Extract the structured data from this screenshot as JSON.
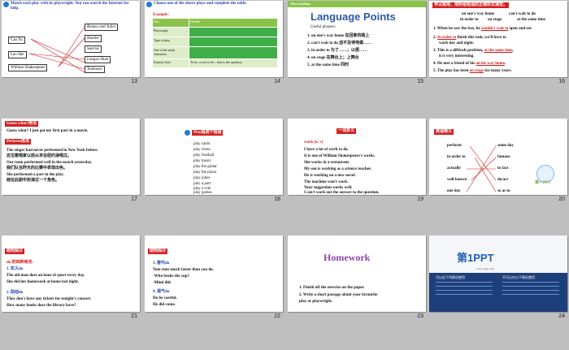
{
  "slides": {
    "s13": {
      "number": "13",
      "instruction": "Match each play with its playwright. You can search the Internet for help.",
      "playwrights": [
        "Cao Yu",
        "Lao She",
        "William Shakespeare"
      ],
      "plays": [
        "Romeo and Juliet",
        "Hamlet",
        "Sunrise",
        "Longxu Slum",
        "Teahouse",
        "Thunderstorm",
        "Camel Xiangzi"
      ]
    },
    "s14": {
      "number": "14",
      "instruction": "Choose one of the above plays and complete the table.",
      "example_label": "Example:",
      "rows": [
        {
          "label": "Play",
          "value": "Hamlet"
        },
        {
          "label": "Playwright",
          "value": ""
        },
        {
          "label": "Type of play",
          "value": ""
        },
        {
          "label": "One of the main characters",
          "value": ""
        },
        {
          "label": "Famous Line",
          "value": "To be, or not to be – that is the question."
        }
      ]
    },
    "s15": {
      "number": "15",
      "tag": "Post-reading",
      "title": "Language Points",
      "subtitle": "Useful phrases:",
      "items": [
        "1.  on one's way home  在回家的路上",
        "2.  can't wait to do  迫不及待地做……",
        "3.  in order to  为了……；以便……",
        "4.  on stage  在舞台上；上舞台",
        "5.  at the same time  同时"
      ]
    },
    "s16": {
      "number": "16",
      "tag": "学以致用，用所给短语的正确形式填空。",
      "phrase_row1": [
        "on one's way home",
        "can't wait to do"
      ],
      "phrase_row2": [
        "in order to",
        "on stage",
        "at the same time"
      ],
      "sentences": [
        {
          "pre": "1. When he saw the box, he ",
          "ans": "couldn't wait to",
          "post": " open and see"
        },
        {
          "pre": "2. ",
          "ans": "In order to",
          "post": " finish this task, we'll have to"
        },
        {
          "pre": "work day and night.",
          "ans": "",
          "post": ""
        },
        {
          "pre": "3. This is a difficult problem, ",
          "ans": "at the same time",
          "post": ","
        },
        {
          "pre": "it is very interesting.",
          "ans": "",
          "post": ""
        },
        {
          "pre": "4. He met a friend of his ",
          "ans": "on his way home",
          "post": "."
        },
        {
          "pre": "5. The play has been ",
          "ans": "on stage",
          "post": " for many years."
        }
      ]
    },
    "s17": {
      "number": "17",
      "tag1": "Guess what?用法",
      "line1": "Guess what? I just got my first part in a movie.",
      "tag2": "Perform用法",
      "lines": [
        "The singer had never performed in New York before.",
        "这位歌唱家以前从未在纽约演唱过。",
        "Our team performed well in the match yesterday.",
        "我们队在昨天的比赛中表现出色。",
        "She performed a part in the play.",
        "她在此剧中扮演过一个角色。"
      ]
    },
    "s18": {
      "number": "18",
      "tag": "Play组成个短语",
      "items": [
        "play cards",
        "play chess",
        "play football",
        "play music",
        "play the guitar",
        "play the piano",
        "play jokes",
        "play a part",
        "play a role",
        "play games"
      ]
    },
    "s19": {
      "number": "19",
      "tag": "一词多义",
      "head": "work  (n. v)",
      "lines": [
        "I have a lot of work to do.",
        "It is one of William Shakespeare's works.",
        "She works in a restaurant.",
        "My son is working as a science teacher.",
        "He is working on a new novel.",
        "The machine won't work.",
        "Your suggestion works well.",
        "I can't work out the answer to the question."
      ]
    },
    "s20": {
      "number": "20",
      "tag": "英语释义",
      "left": [
        "perform",
        "in order to",
        "actually",
        "well known",
        "one day"
      ],
      "right": [
        "some day",
        "famous",
        "in fact",
        "do/act",
        "so as to"
      ],
      "logo": "第一PPT"
    },
    "s21": {
      "number": "21",
      "tag": "结构探讨",
      "head": "do 的四种用法:",
      "sub1": "1. 实义do",
      "l1": "The old man does an hour of sport every day.",
      "l2": "She did her homework at home last night.",
      "sub2": "2. 助动do",
      "l3": "They don't have any tickets for tonight's concert.",
      "l4": "How many books does the library have?"
    },
    "s22": {
      "number": "22",
      "tag": "结构探讨",
      "sub1": "3. 替代do",
      "l1": "Tom runs much faster than you do.",
      "l2": "-Who broke the cup?",
      "l3": "-Mimi did.",
      "sub2": "4. 语气do",
      "l4": "Do be careful.",
      "l5": "He did come."
    },
    "s23": {
      "number": "23",
      "title": "Homework",
      "l1": "1. Finish off the exercise on the paper.",
      "l2": "2. Write a short passage about your favourite",
      "l3": "play or playwright."
    },
    "s24": {
      "number": "24",
      "brand": "第1PPT",
      "url": "www.1ppt.com",
      "left_caption": "可以在下列情况使用",
      "right_caption": "不可以在以下情况使用"
    }
  },
  "colors": {
    "green": "#8bc34a",
    "blue": "#2b5aa8",
    "red": "#d01818",
    "background": "#bfbfbf"
  }
}
